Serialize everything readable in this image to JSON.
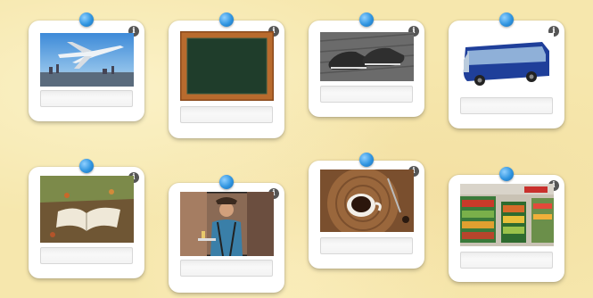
{
  "cards": [
    {
      "image": "airplane",
      "info_icon": "i"
    },
    {
      "image": "chalkboard",
      "info_icon": "i"
    },
    {
      "image": "shoes",
      "info_icon": "i"
    },
    {
      "image": "bus",
      "info_icon": "i"
    },
    {
      "image": "book",
      "info_icon": "i"
    },
    {
      "image": "waiter",
      "info_icon": "i"
    },
    {
      "image": "coffee",
      "info_icon": "i"
    },
    {
      "image": "supermarket",
      "info_icon": "i"
    }
  ],
  "colors": {
    "background": "#f6e7ad",
    "pin": "#2f94e0",
    "card": "#ffffff"
  }
}
